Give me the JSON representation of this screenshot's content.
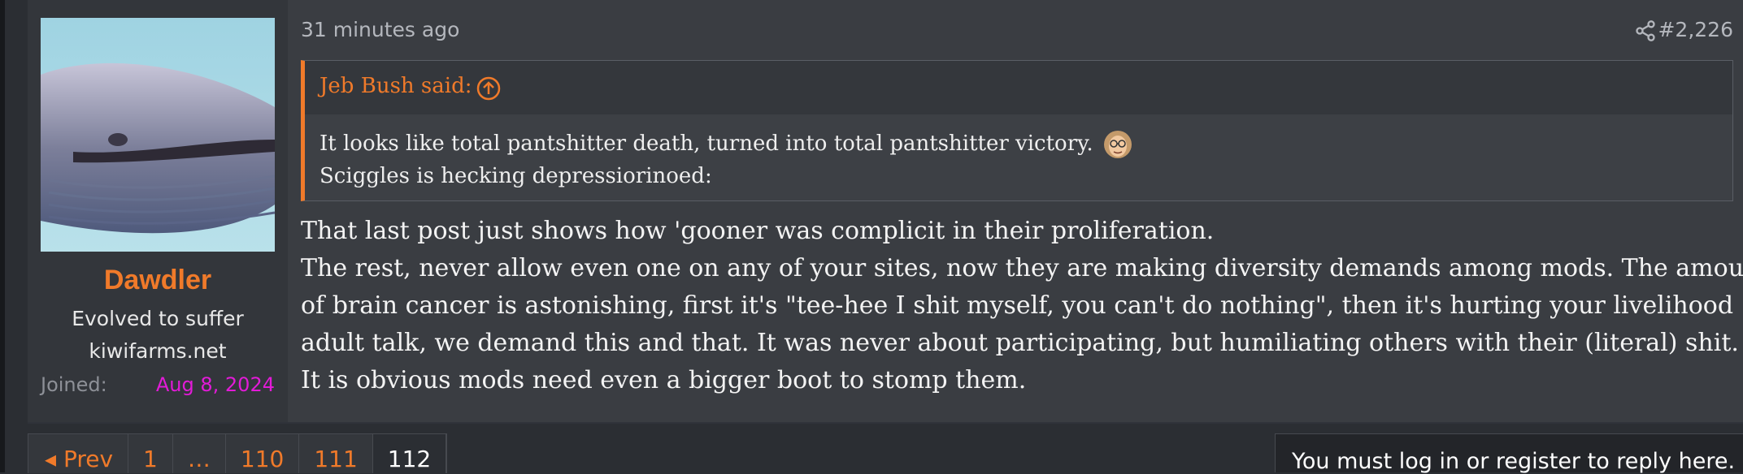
{
  "user": {
    "name": "Dawdler",
    "title": "Evolved to suffer",
    "site": "kiwifarms.net",
    "joined_label": "Joined:",
    "joined_value": "Aug 8, 2024",
    "avatar_icon": "whale-avatar",
    "name_color": "#f07a2a",
    "joined_color": "#e21bd7"
  },
  "post": {
    "date": "31 minutes ago",
    "number": "#2,226",
    "share_icon": "share-icon",
    "quote": {
      "author": "Jeb Bush said:",
      "goto_icon": "arrow-up-circle-icon",
      "lines": [
        "It looks like total pantshitter death, turned into total pantshitter victory.",
        "Sciggles is hecking depressiorinoed:"
      ],
      "emoji": "face-emoji"
    },
    "message_lines": [
      "That last post just shows how 'gooner was complicit in their proliferation.",
      "The rest, never allow even one on any of your sites, now they are making diversity demands among mods. The amount",
      "of brain cancer is astonishing, first it's \"tee-hee I shit myself, you can't do nothing\", then it's hurting your livelihood",
      "adult talk, we demand this and that. It was never about participating, but humiliating others with their (literal) shit.",
      "It is obvious mods need even a bigger boot to stomp them."
    ]
  },
  "pagination": {
    "prev_label": "◂ Prev",
    "pages": [
      "1",
      "…",
      "110",
      "111",
      "112"
    ],
    "current": "112"
  },
  "reply_notice": "You must log in or register to reply here.",
  "colors": {
    "accent": "#f07a2a",
    "background": "#2b2e33",
    "post_bg": "#3a3d42"
  }
}
